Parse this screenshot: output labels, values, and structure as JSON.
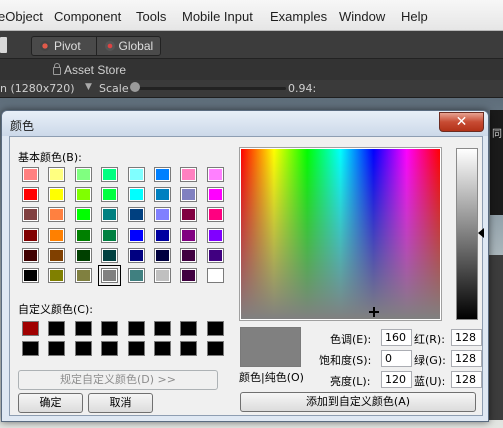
{
  "editor": {
    "menu": [
      "eObject",
      "Component",
      "Tools",
      "Mobile Input",
      "Examples",
      "Window",
      "Help"
    ],
    "toolbar": {
      "pivot": "Pivot",
      "global": "Global"
    },
    "asset_store": "Asset Store",
    "game_view": {
      "resolution": "n (1280x720)",
      "scale_label": "Scale",
      "scale_value": "0.94:"
    }
  },
  "dialog": {
    "title": "颜色",
    "close_label": "✕",
    "basic_colors_label": "基本颜色(B):",
    "basic_colors": [
      [
        "#ff8080",
        "#ffff80",
        "#80ff80",
        "#00ff80",
        "#80ffff",
        "#0080ff",
        "#ff80c0",
        "#ff80ff"
      ],
      [
        "#ff0000",
        "#ffff00",
        "#80ff00",
        "#00ff40",
        "#00ffff",
        "#0080c0",
        "#8080c0",
        "#ff00ff"
      ],
      [
        "#804040",
        "#ff8040",
        "#00ff00",
        "#008080",
        "#004080",
        "#8080ff",
        "#800040",
        "#ff0080"
      ],
      [
        "#800000",
        "#ff8000",
        "#008000",
        "#008040",
        "#0000ff",
        "#0000a0",
        "#800080",
        "#8000ff"
      ],
      [
        "#400000",
        "#804000",
        "#004000",
        "#004040",
        "#000080",
        "#000040",
        "#400040",
        "#400080"
      ],
      [
        "#000000",
        "#808000",
        "#808040",
        "#808080",
        "#408080",
        "#c0c0c0",
        "#400040",
        "#ffffff"
      ]
    ],
    "selected_basic": "#808080",
    "custom_colors_label": "自定义颜色(C):",
    "custom_colors": [
      [
        "#a00000",
        "#000000",
        "#000000",
        "#000000",
        "#000000",
        "#000000",
        "#000000",
        "#000000"
      ],
      [
        "#000000",
        "#000000",
        "#000000",
        "#000000",
        "#000000",
        "#000000",
        "#000000",
        "#000000"
      ]
    ],
    "define_custom_button": "规定自定义颜色(D) >>",
    "ok_button": "确定",
    "cancel_button": "取消",
    "preview_label": "颜色|纯色(O)",
    "hue_label": "色调(E):",
    "hue": "160",
    "sat_label": "饱和度(S):",
    "sat": "0",
    "lum_label": "亮度(L):",
    "lum": "120",
    "red_label": "红(R):",
    "red": "128",
    "green_label": "绿(G):",
    "green": "128",
    "blue_label": "蓝(U):",
    "blue": "128",
    "add_custom_button": "添加到自定义颜色(A)",
    "current_color": "#808080"
  },
  "scene": {
    "hint": "同"
  }
}
